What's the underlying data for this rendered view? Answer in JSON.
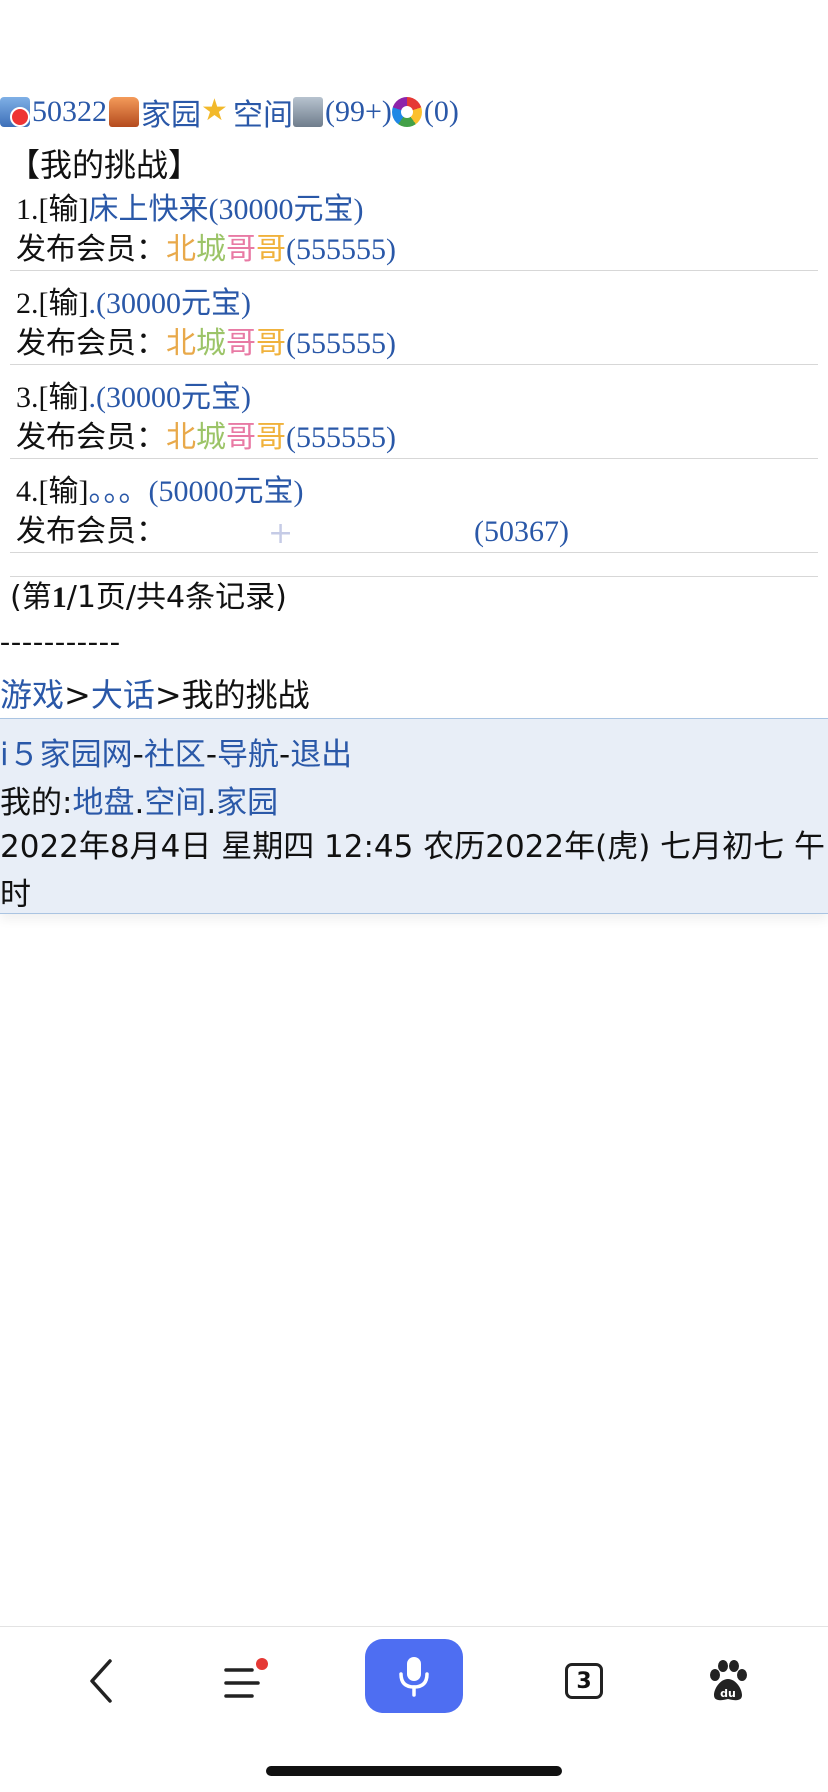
{
  "topbar": {
    "user_id": "50322",
    "home_label": "家园",
    "space_label": "空间",
    "msg_count": "(99+)",
    "wheel_count": "(0)"
  },
  "section_title": "【我的挑战】",
  "records": [
    {
      "prefix": "1.[输]",
      "title": "床上快来(30000元宝)",
      "member_label": "发布会员：",
      "member_name_chars": [
        "北",
        "城",
        "哥",
        "哥"
      ],
      "member_id": "(555555)"
    },
    {
      "prefix": "2.[输]",
      "title": ".(30000元宝)",
      "member_label": "发布会员：",
      "member_name_chars": [
        "北",
        "城",
        "哥",
        "哥"
      ],
      "member_id": "(555555)"
    },
    {
      "prefix": "3.[输]",
      "title": ".(30000元宝)",
      "member_label": "发布会员：",
      "member_name_chars": [
        "北",
        "城",
        "哥",
        "哥"
      ],
      "member_id": "(555555)"
    },
    {
      "prefix": "4.[输]",
      "title": "。。。(50000元宝)",
      "member_label": "发布会员：",
      "member_name_chars": [],
      "member_id": "(50367)"
    }
  ],
  "pager": {
    "pre": "(第",
    "page": "1",
    "post": "/1页/共4条记录)"
  },
  "dashes": "-----------",
  "breadcrumb": {
    "game": "游戏",
    "sep1": ">",
    "dahua": "大话",
    "sep2": ">",
    "current": "我的挑战"
  },
  "footer": {
    "site": "i５家园网",
    "sep": "-",
    "community": "社区",
    "nav": "导航",
    "logout": "退出",
    "mine_label": "我的:",
    "turf": "地盘",
    "dot": ".",
    "space": "空间",
    "home": "家园",
    "datetime": "2022年8月4日  星期四  12:45  农历2022年(虎)  七月初七  午时"
  },
  "toolbar": {
    "icons": [
      "back-icon",
      "menu-icon",
      "mic-icon",
      "tabs-icon",
      "baidu-paw-icon"
    ],
    "tab_count": "3",
    "accent": "#4e6ef2",
    "badge_color": "#e53935"
  }
}
